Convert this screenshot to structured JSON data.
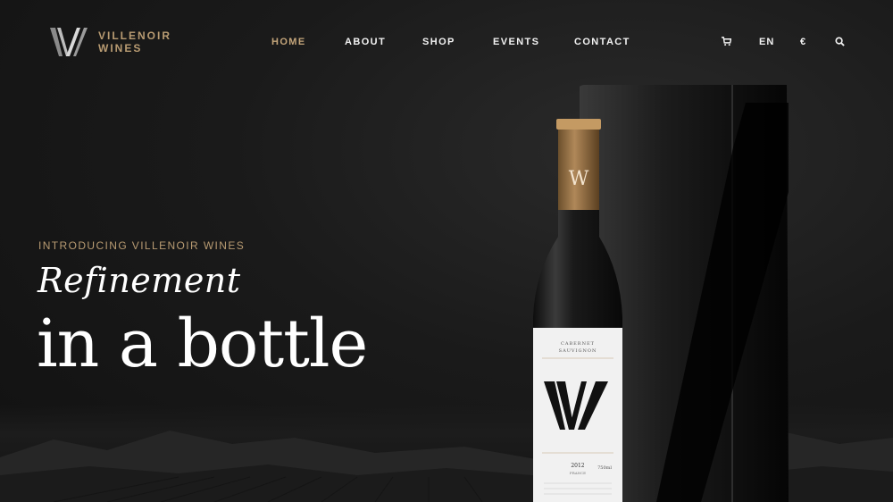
{
  "brand": {
    "name_line1": "VILLENOIR",
    "name_line2": "WINES",
    "logo_icon": "w-monogram-icon"
  },
  "nav": {
    "items": [
      {
        "label": "HOME",
        "active": true
      },
      {
        "label": "ABOUT",
        "active": false
      },
      {
        "label": "SHOP",
        "active": false
      },
      {
        "label": "EVENTS",
        "active": false
      },
      {
        "label": "CONTACT",
        "active": false
      }
    ]
  },
  "tools": {
    "cart_icon": "cart-icon",
    "language": "EN",
    "currency": "€",
    "search_icon": "search-icon"
  },
  "hero": {
    "eyebrow": "INTRODUCING VILLENOIR WINES",
    "headline_italic": "Refinement",
    "headline_main": "in a bottle"
  },
  "bottle": {
    "label_line1": "CABERNET",
    "label_line2": "SAUVIGNON",
    "label_monogram": "W",
    "label_year": "2012",
    "label_country": "FRANCE",
    "label_volume": "750ml"
  },
  "colors": {
    "accent": "#c4a57a",
    "background": "#141414",
    "text": "#ffffff"
  }
}
